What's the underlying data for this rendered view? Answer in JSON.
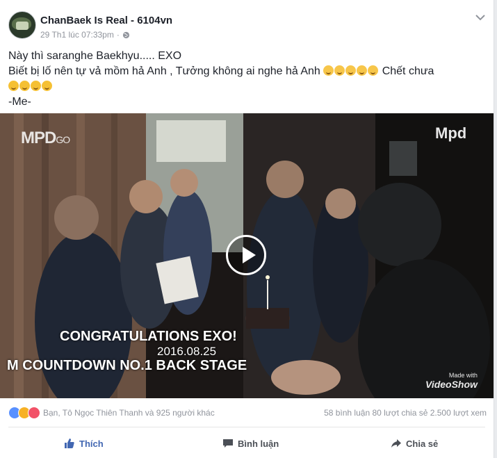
{
  "post": {
    "page_name": "ChanBaek Is Real - 6104vn",
    "timestamp": "29 Th1 lúc 07:33pm",
    "separator": "·",
    "text_line1": "Này thì saranghe Baekhyu..... EXO",
    "text_line2": "Biết bị lố nên tự vả mồm hả Anh , Tưởng không ai nghe hả Anh",
    "text_line2_suffix": "Chết chưa",
    "text_line4": "-Me-"
  },
  "video": {
    "logo_left": "MPD",
    "logo_left_small": "GO",
    "logo_right": "Mpd",
    "caption_line1": "CONGRATULATIONS EXO!",
    "caption_line2": "2016.08.25",
    "caption_line3": "M COUNTDOWN NO.1 BACK STAGE",
    "watermark_line1": "Made with",
    "watermark_line2": "VideoShow"
  },
  "stats": {
    "reaction_names": "Bạn, Tô Ngọc Thiên Thanh và 925 người khác",
    "counts": "58 bình luận  80 lượt chia sẻ  2.500 lượt xem"
  },
  "actions": {
    "like": "Thích",
    "comment": "Bình luận",
    "share": "Chia sẻ"
  },
  "colors": {
    "brand": "#4267b2",
    "meta": "#90949c"
  }
}
